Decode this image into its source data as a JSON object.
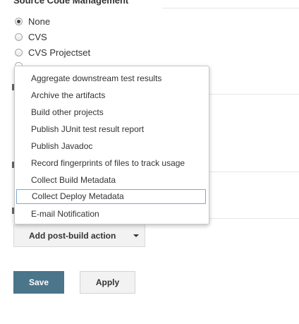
{
  "scm": {
    "title": "Source Code Management",
    "options": [
      {
        "label": "None",
        "checked": true
      },
      {
        "label": "CVS",
        "checked": false
      },
      {
        "label": "CVS Projectset",
        "checked": false
      }
    ]
  },
  "post_build_menu": {
    "items": [
      "Aggregate downstream test results",
      "Archive the artifacts",
      "Build other projects",
      "Publish JUnit test result report",
      "Publish Javadoc",
      "Record fingerprints of files to track usage",
      "Collect Build Metadata",
      "Collect Deploy Metadata",
      "E-mail Notification"
    ],
    "highlighted_item": "Collect Deploy Metadata"
  },
  "add_post_build_action": {
    "label": "Add post-build action",
    "icon": "caret-down-icon"
  },
  "footer": {
    "save_label": "Save",
    "apply_label": "Apply"
  },
  "colors": {
    "save_bg": "#4b758b",
    "highlight_border": "#7aa7d6"
  }
}
